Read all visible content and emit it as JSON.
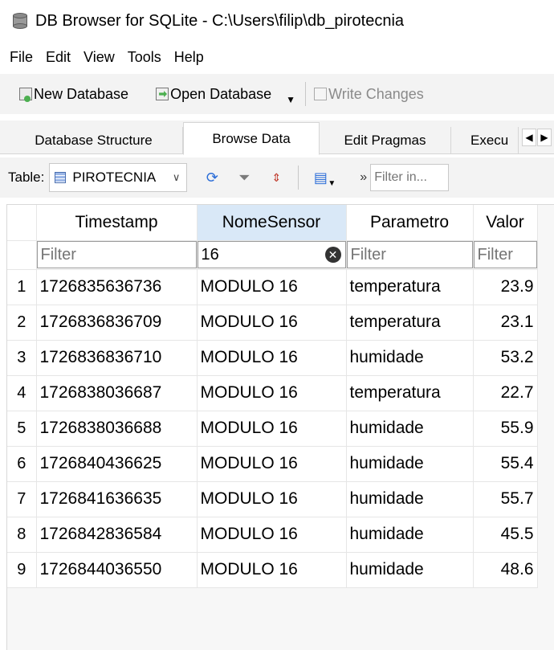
{
  "window": {
    "title": "DB Browser for SQLite - C:\\Users\\filip\\db_pirotecnia"
  },
  "menu": [
    "File",
    "Edit",
    "View",
    "Tools",
    "Help"
  ],
  "toolbar": {
    "new_database": "New Database",
    "open_database": "Open Database",
    "write_changes": "Write Changes"
  },
  "tabs": [
    {
      "label": "Database Structure",
      "active": false
    },
    {
      "label": "Browse Data",
      "active": true
    },
    {
      "label": "Edit Pragmas",
      "active": false
    },
    {
      "label": "Execu",
      "active": false
    }
  ],
  "browse": {
    "table_label": "Table:",
    "table_name": "PIROTECNIA",
    "filter_placeholder": "Filter in..."
  },
  "grid": {
    "columns": [
      "Timestamp",
      "NomeSensor",
      "Parametro",
      "Valor"
    ],
    "active_column": "NomeSensor",
    "filter_placeholder": "Filter",
    "filter_values": [
      "",
      "16",
      "",
      ""
    ],
    "rows": [
      {
        "n": "1",
        "Timestamp": "1726835636736",
        "NomeSensor": "MODULO 16",
        "Parametro": "temperatura",
        "Valor": "23.9"
      },
      {
        "n": "2",
        "Timestamp": "1726836836709",
        "NomeSensor": "MODULO 16",
        "Parametro": "temperatura",
        "Valor": "23.1"
      },
      {
        "n": "3",
        "Timestamp": "1726836836710",
        "NomeSensor": "MODULO 16",
        "Parametro": "humidade",
        "Valor": "53.2"
      },
      {
        "n": "4",
        "Timestamp": "1726838036687",
        "NomeSensor": "MODULO 16",
        "Parametro": "temperatura",
        "Valor": "22.7"
      },
      {
        "n": "5",
        "Timestamp": "1726838036688",
        "NomeSensor": "MODULO 16",
        "Parametro": "humidade",
        "Valor": "55.9"
      },
      {
        "n": "6",
        "Timestamp": "1726840436625",
        "NomeSensor": "MODULO 16",
        "Parametro": "humidade",
        "Valor": "55.4"
      },
      {
        "n": "7",
        "Timestamp": "1726841636635",
        "NomeSensor": "MODULO 16",
        "Parametro": "humidade",
        "Valor": "55.7"
      },
      {
        "n": "8",
        "Timestamp": "1726842836584",
        "NomeSensor": "MODULO 16",
        "Parametro": "humidade",
        "Valor": "45.5"
      },
      {
        "n": "9",
        "Timestamp": "1726844036550",
        "NomeSensor": "MODULO 16",
        "Parametro": "humidade",
        "Valor": "48.6"
      }
    ]
  },
  "icons": {
    "app": "database-icon",
    "new": "new-document-icon",
    "open": "open-folder-icon",
    "write": "write-changes-icon",
    "refresh": "refresh-icon",
    "clear_filters": "clear-filters-icon",
    "sort": "sort-icon",
    "save": "save-table-icon",
    "clear": "clear-filter-icon"
  },
  "colors": {
    "active_header": "#d9e8f7",
    "toolbar_bg": "#f3f3f3"
  }
}
